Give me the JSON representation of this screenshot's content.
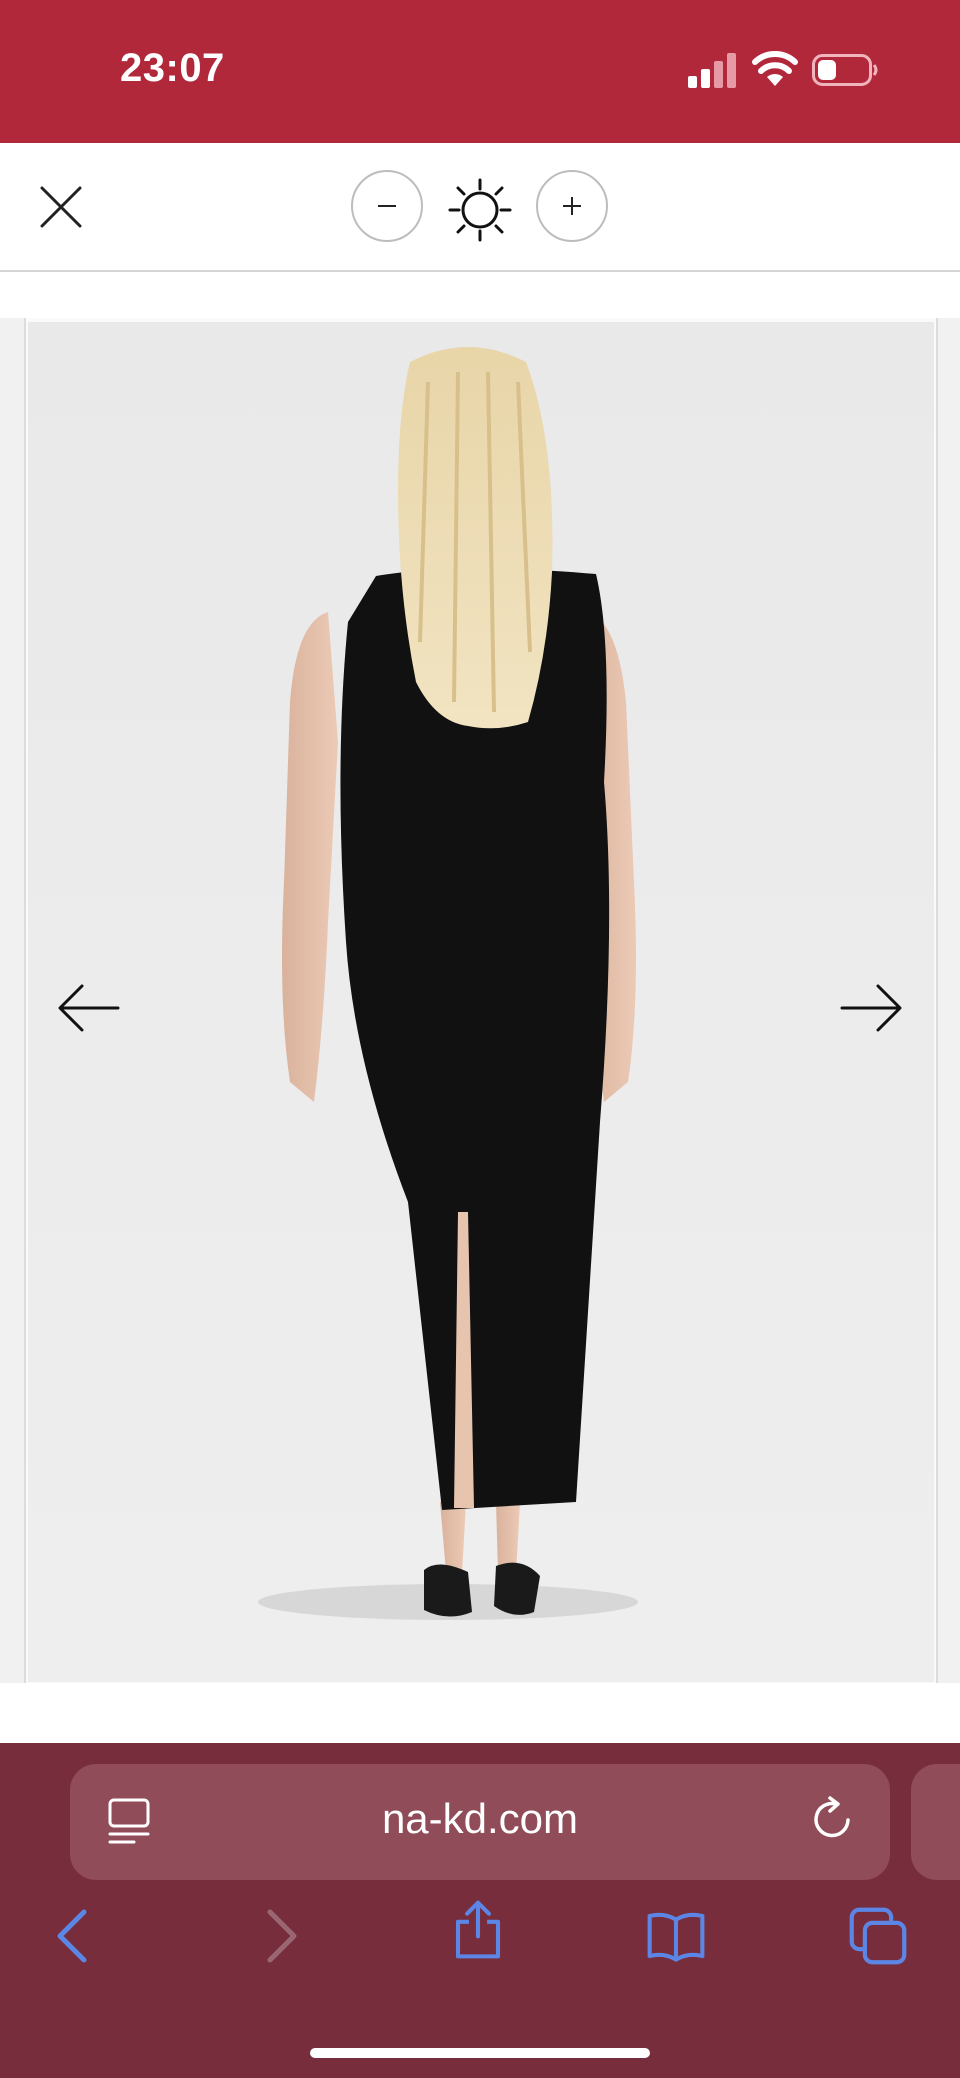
{
  "status_bar": {
    "time": "23:07",
    "background": "#b1283b",
    "icons": [
      "signal-icon",
      "wifi-icon",
      "battery-icon"
    ]
  },
  "viewer_toolbar": {
    "icons": [
      "close-icon",
      "zoom-out-icon",
      "brightness-icon",
      "zoom-in-icon"
    ]
  },
  "image_viewer": {
    "subject": "product-photo",
    "icons": [
      "arrow-left-icon",
      "arrow-right-icon"
    ]
  },
  "browser": {
    "url": "na-kd.com",
    "background": "#772d3b",
    "address_bar_color": "#904c58",
    "accent": "#5b86e5",
    "icons": [
      "reader-icon",
      "reload-icon",
      "back-icon",
      "forward-icon",
      "share-icon",
      "bookmarks-icon",
      "tabs-icon"
    ]
  }
}
